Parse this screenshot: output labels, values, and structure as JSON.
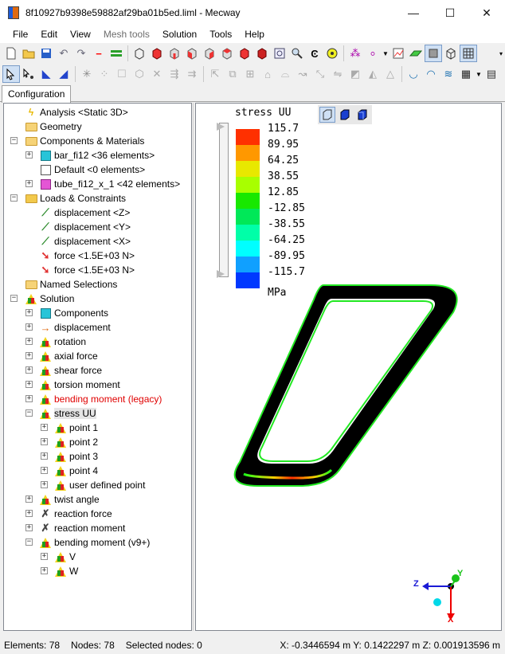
{
  "window": {
    "title": "8f10927b9398e59882af29ba01b5ed.liml - Mecway",
    "minimize": "—",
    "maximize": "☐",
    "close": "✕"
  },
  "menu": [
    "File",
    "Edit",
    "View",
    "Mesh tools",
    "Solution",
    "Tools",
    "Help"
  ],
  "menu_disabled": [
    "Mesh tools"
  ],
  "tab": "Configuration",
  "tree": [
    {
      "label": "Analysis <Static 3D>",
      "icon": "lightning-icon",
      "depth": 1,
      "expander": ""
    },
    {
      "label": "Geometry",
      "icon": "folder-icon",
      "depth": 1,
      "expander": ""
    },
    {
      "label": "Components & Materials",
      "icon": "folder-icon",
      "depth": 1,
      "expander": "−"
    },
    {
      "label": "bar_fi12 <36 elements>",
      "icon": "component-cyan-icon",
      "depth": 2,
      "expander": "+"
    },
    {
      "label": "Default <0 elements>",
      "icon": "component-white-icon",
      "depth": 2,
      "expander": ""
    },
    {
      "label": "tube_fi12_x_1 <42 elements>",
      "icon": "component-pink-icon",
      "depth": 2,
      "expander": "+"
    },
    {
      "label": "Loads & Constraints",
      "icon": "loads-folder-icon",
      "depth": 1,
      "expander": "−"
    },
    {
      "label": "displacement <Z>",
      "icon": "displacement-icon",
      "depth": 2,
      "expander": ""
    },
    {
      "label": "displacement <Y>",
      "icon": "displacement-icon",
      "depth": 2,
      "expander": ""
    },
    {
      "label": "displacement <X>",
      "icon": "displacement-icon",
      "depth": 2,
      "expander": ""
    },
    {
      "label": "force <1.5E+03 N>",
      "icon": "force-icon",
      "depth": 2,
      "expander": ""
    },
    {
      "label": "force <1.5E+03 N>",
      "icon": "force-icon",
      "depth": 2,
      "expander": ""
    },
    {
      "label": "Named Selections",
      "icon": "named-selection-icon",
      "depth": 1,
      "expander": ""
    },
    {
      "label": "Solution",
      "icon": "solution-icon",
      "depth": 1,
      "expander": "−"
    },
    {
      "label": "Components",
      "icon": "components-result-icon",
      "depth": 2,
      "expander": "+"
    },
    {
      "label": "displacement",
      "icon": "displacement-result-icon",
      "depth": 2,
      "expander": "+"
    },
    {
      "label": "rotation",
      "icon": "result-triangle-icon",
      "depth": 2,
      "expander": "+"
    },
    {
      "label": "axial force",
      "icon": "result-triangle-icon",
      "depth": 2,
      "expander": "+"
    },
    {
      "label": "shear force",
      "icon": "result-triangle-icon",
      "depth": 2,
      "expander": "+"
    },
    {
      "label": "torsion moment",
      "icon": "result-triangle-icon",
      "depth": 2,
      "expander": "+"
    },
    {
      "label": "bending moment (legacy)",
      "icon": "result-triangle-icon",
      "depth": 2,
      "expander": "+",
      "red": true
    },
    {
      "label": "stress UU",
      "icon": "result-triangle-icon",
      "depth": 2,
      "expander": "−",
      "selected": true
    },
    {
      "label": "point 1",
      "icon": "result-triangle-icon",
      "depth": 3,
      "expander": "+"
    },
    {
      "label": "point 2",
      "icon": "result-triangle-icon",
      "depth": 3,
      "expander": "+"
    },
    {
      "label": "point 3",
      "icon": "result-triangle-icon",
      "depth": 3,
      "expander": "+"
    },
    {
      "label": "point 4",
      "icon": "result-triangle-icon",
      "depth": 3,
      "expander": "+"
    },
    {
      "label": "user defined point",
      "icon": "result-triangle-icon",
      "depth": 3,
      "expander": "+"
    },
    {
      "label": "twist angle",
      "icon": "result-triangle-icon",
      "depth": 2,
      "expander": "+"
    },
    {
      "label": "reaction force",
      "icon": "reaction-icon",
      "depth": 2,
      "expander": "+"
    },
    {
      "label": "reaction moment",
      "icon": "reaction-icon",
      "depth": 2,
      "expander": "+"
    },
    {
      "label": "bending moment (v9+)",
      "icon": "result-triangle-icon",
      "depth": 2,
      "expander": "−"
    },
    {
      "label": "V",
      "icon": "result-triangle-icon",
      "depth": 3,
      "expander": "+"
    },
    {
      "label": "W",
      "icon": "result-triangle-icon",
      "depth": 3,
      "expander": "+"
    }
  ],
  "legend": {
    "title": "stress UU",
    "unit": "MPa",
    "values": [
      "115.7",
      "89.95",
      "64.25",
      "38.55",
      "12.85",
      "-12.85",
      "-38.55",
      "-64.25",
      "-89.95",
      "-115.7"
    ],
    "colors": [
      "#ff3000",
      "#ff9800",
      "#e8e800",
      "#a8ff00",
      "#18e800",
      "#00e858",
      "#00ffa8",
      "#00ffff",
      "#10a0ff",
      "#0038ff"
    ]
  },
  "triad": {
    "z": "Z",
    "y": "Y",
    "x": "X"
  },
  "status": {
    "elements": "Elements: 78",
    "nodes": "Nodes: 78",
    "selected": "Selected nodes: 0",
    "coords": "X: -0.3446594 m Y: 0.1422297 m Z: 0.001913596 m"
  }
}
